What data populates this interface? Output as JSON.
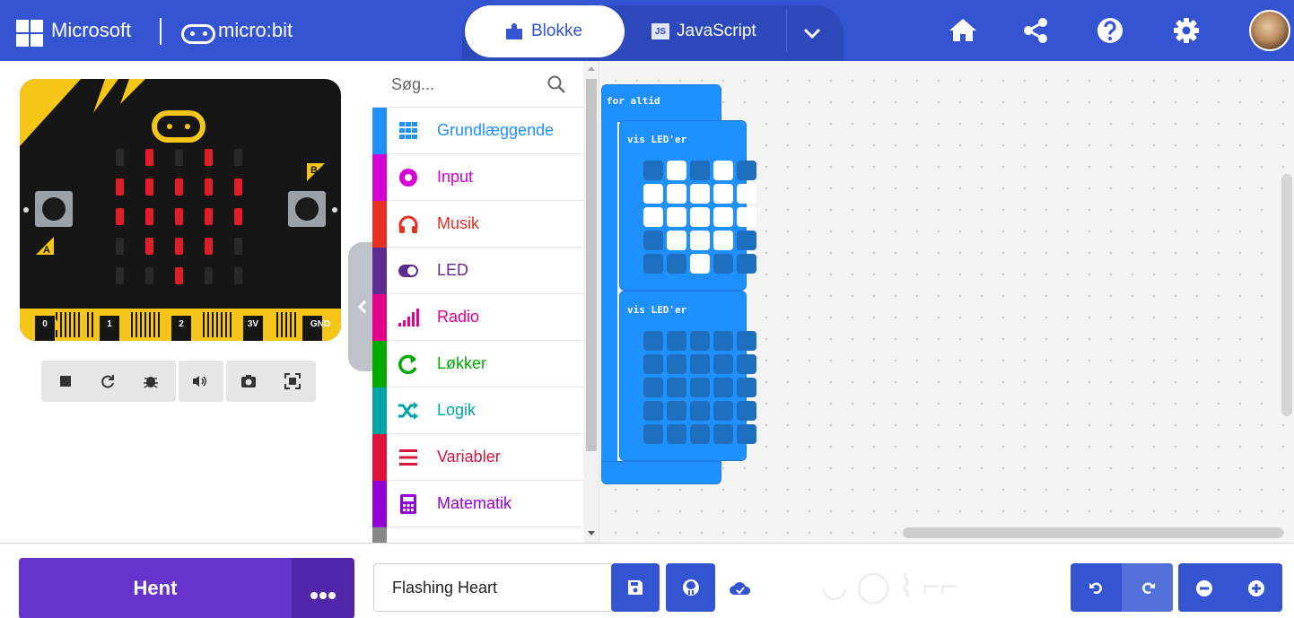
{
  "header": {
    "brand": "Microsoft",
    "product": "micro:bit",
    "tabs": [
      {
        "label": "Blokke",
        "active": true
      },
      {
        "label": "JavaScript",
        "badge": "JS",
        "active": false
      }
    ],
    "icons": [
      "home-icon",
      "share-icon",
      "help-icon",
      "settings-icon",
      "avatar"
    ]
  },
  "simulator": {
    "pins": [
      "0",
      "1",
      "2",
      "3V",
      "GND"
    ],
    "button_a": "A",
    "button_b": "B",
    "led_matrix": [
      [
        0,
        1,
        0,
        1,
        0
      ],
      [
        1,
        1,
        1,
        1,
        1
      ],
      [
        1,
        1,
        1,
        1,
        1
      ],
      [
        0,
        1,
        1,
        1,
        0
      ],
      [
        0,
        0,
        1,
        0,
        0
      ]
    ],
    "led_color": "#e01e2b",
    "controls": [
      "stop-icon",
      "restart-icon",
      "debug-icon",
      "sound-icon",
      "screenshot-icon",
      "fullscreen-icon"
    ]
  },
  "toolbox": {
    "search_placeholder": "Søg...",
    "categories": [
      {
        "label": "Grundlæggende",
        "color": "#1e90ff",
        "icon": "grid-icon"
      },
      {
        "label": "Input",
        "color": "#d400d4",
        "icon": "input-icon"
      },
      {
        "label": "Musik",
        "color": "#e63022",
        "icon": "headphones-icon"
      },
      {
        "label": "LED",
        "color": "#5c2d91",
        "icon": "toggle-icon"
      },
      {
        "label": "Radio",
        "color": "#e3008c",
        "icon": "signal-icon"
      },
      {
        "label": "Løkker",
        "color": "#00aa00",
        "icon": "loop-icon"
      },
      {
        "label": "Logik",
        "color": "#00a4a6",
        "icon": "shuffle-icon"
      },
      {
        "label": "Variabler",
        "color": "#dc143c",
        "icon": "variables-icon"
      },
      {
        "label": "Matematik",
        "color": "#9400d3",
        "icon": "calculator-icon"
      }
    ]
  },
  "workspace": {
    "forever_label": "for altid",
    "show_leds_label": "vis LED'er",
    "show_leds_1": [
      [
        0,
        1,
        0,
        1,
        0
      ],
      [
        1,
        1,
        1,
        1,
        1
      ],
      [
        1,
        1,
        1,
        1,
        1
      ],
      [
        0,
        1,
        1,
        1,
        0
      ],
      [
        0,
        0,
        1,
        0,
        0
      ]
    ],
    "show_leds_2": [
      [
        0,
        0,
        0,
        0,
        0
      ],
      [
        0,
        0,
        0,
        0,
        0
      ],
      [
        0,
        0,
        0,
        0,
        0
      ],
      [
        0,
        0,
        0,
        0,
        0
      ],
      [
        0,
        0,
        0,
        0,
        0
      ]
    ]
  },
  "footer": {
    "download_label": "Hent",
    "project_name": "Flashing Heart"
  },
  "colors": {
    "header": "#3454d1",
    "download": "#6633cc",
    "block": "#1e90ff"
  }
}
